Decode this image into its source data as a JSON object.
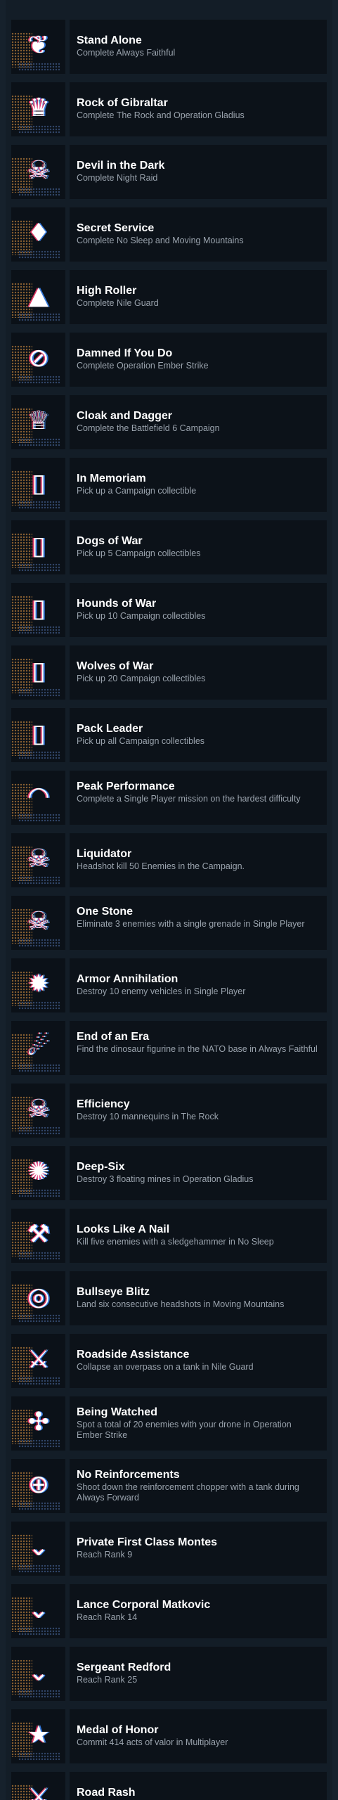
{
  "achievements": [
    {
      "title": "Stand Alone",
      "description": "Complete Always Faithful",
      "icon": "laurel-crest-icon"
    },
    {
      "title": "Rock of Gibraltar",
      "description": "Complete The Rock and Operation Gladius",
      "icon": "crowned-skull-icon"
    },
    {
      "title": "Devil in the Dark",
      "description": "Complete Night Raid",
      "icon": "horned-skull-icon"
    },
    {
      "title": "Secret Service",
      "description": "Complete No Sleep and Moving Mountains",
      "icon": "suit-tie-icon"
    },
    {
      "title": "High Roller",
      "description": "Complete Nile Guard",
      "icon": "mountain-arc-icon"
    },
    {
      "title": "Damned If You Do",
      "description": "Complete Operation Ember Strike",
      "icon": "no-signal-icon"
    },
    {
      "title": "Cloak and Dagger",
      "description": "Complete the Battlefield 6 Campaign",
      "icon": "bf-trophy-icon"
    },
    {
      "title": "In Memoriam",
      "description": "Pick up a Campaign collectible",
      "icon": "dog-tag-01-icon"
    },
    {
      "title": "Dogs of War",
      "description": "Pick up 5 Campaign collectibles",
      "icon": "dog-tag-05-icon"
    },
    {
      "title": "Hounds of War",
      "description": "Pick up 10 Campaign collectibles",
      "icon": "dog-tag-10-icon"
    },
    {
      "title": "Wolves of War",
      "description": "Pick up 20 Campaign collectibles",
      "icon": "dog-tag-20-icon"
    },
    {
      "title": "Pack Leader",
      "description": "Pick up all Campaign collectibles",
      "icon": "dog-tag-bf-icon"
    },
    {
      "title": "Peak Performance",
      "description": "Complete a Single Player mission on the hardest difficulty",
      "icon": "speedometer-icon"
    },
    {
      "title": "Liquidator",
      "description": "Headshot kill 50 Enemies in the Campaign.",
      "icon": "winged-skull-icon"
    },
    {
      "title": "One Stone",
      "description": "Eliminate 3 enemies with a single grenade in Single Player",
      "icon": "exploding-skull-icon"
    },
    {
      "title": "Armor Annihilation",
      "description": "Destroy 10 enemy vehicles in Single Player",
      "icon": "burst-icon"
    },
    {
      "title": "End of an Era",
      "description": "Find the dinosaur figurine in the NATO base in Always Faithful",
      "icon": "meteor-icon"
    },
    {
      "title": "Efficiency",
      "description": "Destroy 10 mannequins in The Rock",
      "icon": "officer-skull-icon"
    },
    {
      "title": "Deep-Six",
      "description": "Destroy 3 floating mines in Operation Gladius",
      "icon": "naval-mine-icon"
    },
    {
      "title": "Looks Like A Nail",
      "description": "Kill five enemies with a sledgehammer in No Sleep",
      "icon": "crossed-hammers-icon"
    },
    {
      "title": "Bullseye Blitz",
      "description": "Land six consecutive headshots in Moving Mountains",
      "icon": "target-skull-icon"
    },
    {
      "title": "Roadside Assistance",
      "description": "Collapse an overpass on a tank in Nile Guard",
      "icon": "crossed-wrenches-icon"
    },
    {
      "title": "Being Watched",
      "description": "Spot a total of 20 enemies with your drone in Operation Ember Strike",
      "icon": "drone-icon"
    },
    {
      "title": "No Reinforcements",
      "description": "Shoot down the reinforcement chopper with a tank during Always Forward",
      "icon": "crosshair-icon"
    },
    {
      "title": "Private First Class Montes",
      "description": "Reach Rank 9",
      "icon": "rank-chevron-icon"
    },
    {
      "title": "Lance Corporal Matkovic",
      "description": "Reach Rank 14",
      "icon": "rank-chevron-icon"
    },
    {
      "title": "Sergeant Redford",
      "description": "Reach Rank 25",
      "icon": "rank-chevron-icon"
    },
    {
      "title": "Medal of Honor",
      "description": "Commit 414 acts of valor in Multiplayer",
      "icon": "star-medal-icon"
    },
    {
      "title": "Road Rash",
      "description": "",
      "icon": "road-rash-icon"
    }
  ]
}
